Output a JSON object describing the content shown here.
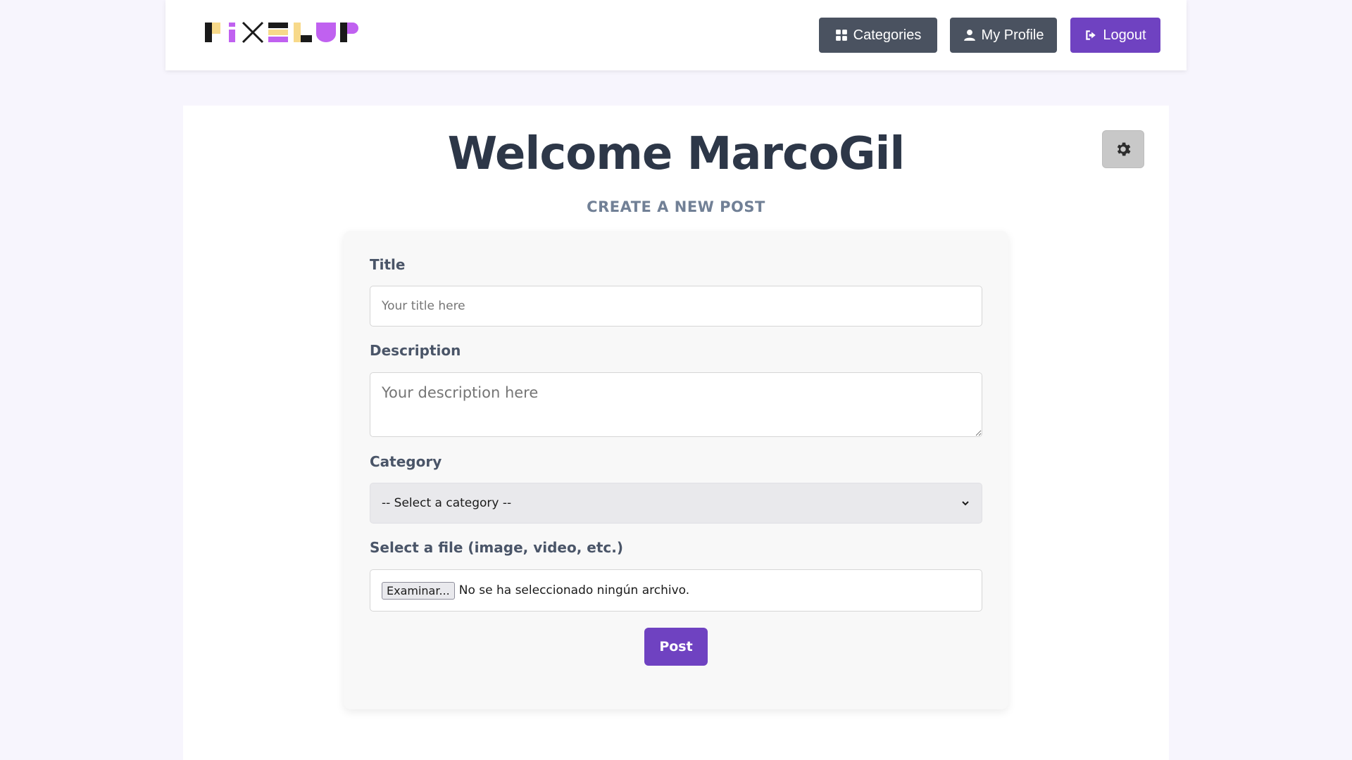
{
  "header": {
    "logo_text": "PIXELUP",
    "nav": {
      "categories_label": "Categories",
      "profile_label": "My Profile",
      "logout_label": "Logout"
    }
  },
  "main": {
    "welcome": "Welcome MarcoGil",
    "subtitle": "CREATE A NEW POST",
    "form": {
      "title_label": "Title",
      "title_placeholder": "Your title here",
      "description_label": "Description",
      "description_placeholder": "Your description here",
      "category_label": "Category",
      "category_selected": "-- Select a category --",
      "file_label": "Select a file (image, video, etc.)",
      "file_button": "Examinar...",
      "file_status": "No se ha seleccionado ningún archivo.",
      "post_button": "Post"
    }
  },
  "colors": {
    "accent": "#6f42c1",
    "nav_dark": "#4a5260",
    "page_bg": "#f7f5fd"
  }
}
